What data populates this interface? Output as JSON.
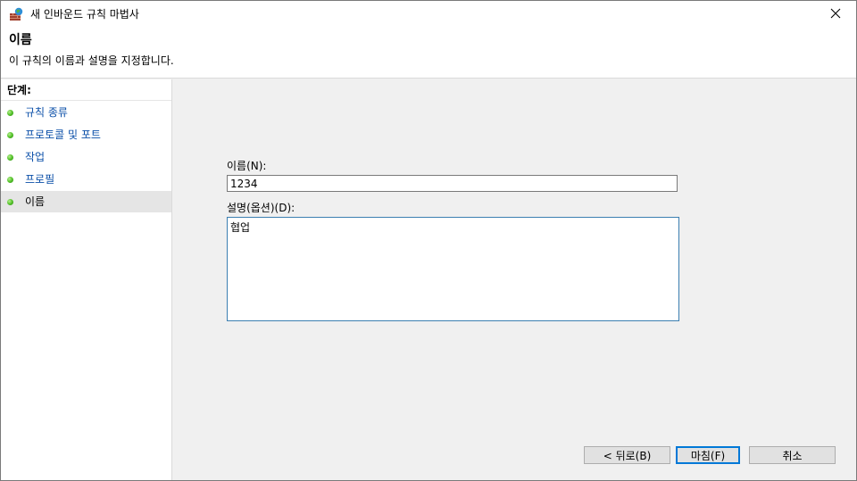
{
  "window": {
    "title": "새 인바운드 규칙 마법사"
  },
  "header": {
    "title": "이름",
    "description": "이 규칙의 이름과 설명을 지정합니다."
  },
  "steps": {
    "heading": "단계:",
    "items": [
      {
        "label": "규칙 종류",
        "current": false
      },
      {
        "label": "프로토콜 및 포트",
        "current": false
      },
      {
        "label": "작업",
        "current": false
      },
      {
        "label": "프로필",
        "current": false
      },
      {
        "label": "이름",
        "current": true
      }
    ]
  },
  "form": {
    "name_label": "이름(N):",
    "name_value": "1234",
    "description_label": "설명(옵션)(D):",
    "description_value": "협업"
  },
  "buttons": {
    "back": "< 뒤로(B)",
    "finish": "마침(F)",
    "cancel": "취소"
  },
  "colors": {
    "link": "#0b4fa8",
    "accent": "#0078d7",
    "step_dot": "#55c22b"
  },
  "icons": {
    "app": "firewall-icon",
    "close": "close-icon",
    "step": "green-dot-icon"
  }
}
